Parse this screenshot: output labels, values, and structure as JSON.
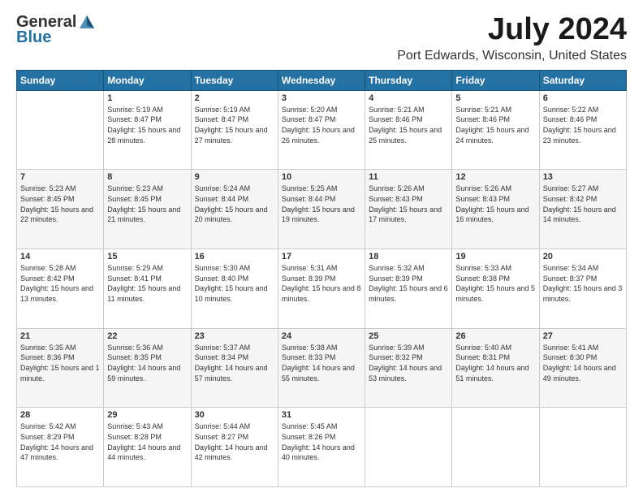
{
  "logo": {
    "general": "General",
    "blue": "Blue"
  },
  "title": "July 2024",
  "subtitle": "Port Edwards, Wisconsin, United States",
  "days": [
    "Sunday",
    "Monday",
    "Tuesday",
    "Wednesday",
    "Thursday",
    "Friday",
    "Saturday"
  ],
  "weeks": [
    [
      {
        "day": "",
        "sunrise": "",
        "sunset": "",
        "daylight": ""
      },
      {
        "day": "1",
        "sunrise": "Sunrise: 5:19 AM",
        "sunset": "Sunset: 8:47 PM",
        "daylight": "Daylight: 15 hours and 28 minutes."
      },
      {
        "day": "2",
        "sunrise": "Sunrise: 5:19 AM",
        "sunset": "Sunset: 8:47 PM",
        "daylight": "Daylight: 15 hours and 27 minutes."
      },
      {
        "day": "3",
        "sunrise": "Sunrise: 5:20 AM",
        "sunset": "Sunset: 8:47 PM",
        "daylight": "Daylight: 15 hours and 26 minutes."
      },
      {
        "day": "4",
        "sunrise": "Sunrise: 5:21 AM",
        "sunset": "Sunset: 8:46 PM",
        "daylight": "Daylight: 15 hours and 25 minutes."
      },
      {
        "day": "5",
        "sunrise": "Sunrise: 5:21 AM",
        "sunset": "Sunset: 8:46 PM",
        "daylight": "Daylight: 15 hours and 24 minutes."
      },
      {
        "day": "6",
        "sunrise": "Sunrise: 5:22 AM",
        "sunset": "Sunset: 8:46 PM",
        "daylight": "Daylight: 15 hours and 23 minutes."
      }
    ],
    [
      {
        "day": "7",
        "sunrise": "Sunrise: 5:23 AM",
        "sunset": "Sunset: 8:45 PM",
        "daylight": "Daylight: 15 hours and 22 minutes."
      },
      {
        "day": "8",
        "sunrise": "Sunrise: 5:23 AM",
        "sunset": "Sunset: 8:45 PM",
        "daylight": "Daylight: 15 hours and 21 minutes."
      },
      {
        "day": "9",
        "sunrise": "Sunrise: 5:24 AM",
        "sunset": "Sunset: 8:44 PM",
        "daylight": "Daylight: 15 hours and 20 minutes."
      },
      {
        "day": "10",
        "sunrise": "Sunrise: 5:25 AM",
        "sunset": "Sunset: 8:44 PM",
        "daylight": "Daylight: 15 hours and 19 minutes."
      },
      {
        "day": "11",
        "sunrise": "Sunrise: 5:26 AM",
        "sunset": "Sunset: 8:43 PM",
        "daylight": "Daylight: 15 hours and 17 minutes."
      },
      {
        "day": "12",
        "sunrise": "Sunrise: 5:26 AM",
        "sunset": "Sunset: 8:43 PM",
        "daylight": "Daylight: 15 hours and 16 minutes."
      },
      {
        "day": "13",
        "sunrise": "Sunrise: 5:27 AM",
        "sunset": "Sunset: 8:42 PM",
        "daylight": "Daylight: 15 hours and 14 minutes."
      }
    ],
    [
      {
        "day": "14",
        "sunrise": "Sunrise: 5:28 AM",
        "sunset": "Sunset: 8:42 PM",
        "daylight": "Daylight: 15 hours and 13 minutes."
      },
      {
        "day": "15",
        "sunrise": "Sunrise: 5:29 AM",
        "sunset": "Sunset: 8:41 PM",
        "daylight": "Daylight: 15 hours and 11 minutes."
      },
      {
        "day": "16",
        "sunrise": "Sunrise: 5:30 AM",
        "sunset": "Sunset: 8:40 PM",
        "daylight": "Daylight: 15 hours and 10 minutes."
      },
      {
        "day": "17",
        "sunrise": "Sunrise: 5:31 AM",
        "sunset": "Sunset: 8:39 PM",
        "daylight": "Daylight: 15 hours and 8 minutes."
      },
      {
        "day": "18",
        "sunrise": "Sunrise: 5:32 AM",
        "sunset": "Sunset: 8:39 PM",
        "daylight": "Daylight: 15 hours and 6 minutes."
      },
      {
        "day": "19",
        "sunrise": "Sunrise: 5:33 AM",
        "sunset": "Sunset: 8:38 PM",
        "daylight": "Daylight: 15 hours and 5 minutes."
      },
      {
        "day": "20",
        "sunrise": "Sunrise: 5:34 AM",
        "sunset": "Sunset: 8:37 PM",
        "daylight": "Daylight: 15 hours and 3 minutes."
      }
    ],
    [
      {
        "day": "21",
        "sunrise": "Sunrise: 5:35 AM",
        "sunset": "Sunset: 8:36 PM",
        "daylight": "Daylight: 15 hours and 1 minute."
      },
      {
        "day": "22",
        "sunrise": "Sunrise: 5:36 AM",
        "sunset": "Sunset: 8:35 PM",
        "daylight": "Daylight: 14 hours and 59 minutes."
      },
      {
        "day": "23",
        "sunrise": "Sunrise: 5:37 AM",
        "sunset": "Sunset: 8:34 PM",
        "daylight": "Daylight: 14 hours and 57 minutes."
      },
      {
        "day": "24",
        "sunrise": "Sunrise: 5:38 AM",
        "sunset": "Sunset: 8:33 PM",
        "daylight": "Daylight: 14 hours and 55 minutes."
      },
      {
        "day": "25",
        "sunrise": "Sunrise: 5:39 AM",
        "sunset": "Sunset: 8:32 PM",
        "daylight": "Daylight: 14 hours and 53 minutes."
      },
      {
        "day": "26",
        "sunrise": "Sunrise: 5:40 AM",
        "sunset": "Sunset: 8:31 PM",
        "daylight": "Daylight: 14 hours and 51 minutes."
      },
      {
        "day": "27",
        "sunrise": "Sunrise: 5:41 AM",
        "sunset": "Sunset: 8:30 PM",
        "daylight": "Daylight: 14 hours and 49 minutes."
      }
    ],
    [
      {
        "day": "28",
        "sunrise": "Sunrise: 5:42 AM",
        "sunset": "Sunset: 8:29 PM",
        "daylight": "Daylight: 14 hours and 47 minutes."
      },
      {
        "day": "29",
        "sunrise": "Sunrise: 5:43 AM",
        "sunset": "Sunset: 8:28 PM",
        "daylight": "Daylight: 14 hours and 44 minutes."
      },
      {
        "day": "30",
        "sunrise": "Sunrise: 5:44 AM",
        "sunset": "Sunset: 8:27 PM",
        "daylight": "Daylight: 14 hours and 42 minutes."
      },
      {
        "day": "31",
        "sunrise": "Sunrise: 5:45 AM",
        "sunset": "Sunset: 8:26 PM",
        "daylight": "Daylight: 14 hours and 40 minutes."
      },
      {
        "day": "",
        "sunrise": "",
        "sunset": "",
        "daylight": ""
      },
      {
        "day": "",
        "sunrise": "",
        "sunset": "",
        "daylight": ""
      },
      {
        "day": "",
        "sunrise": "",
        "sunset": "",
        "daylight": ""
      }
    ]
  ]
}
